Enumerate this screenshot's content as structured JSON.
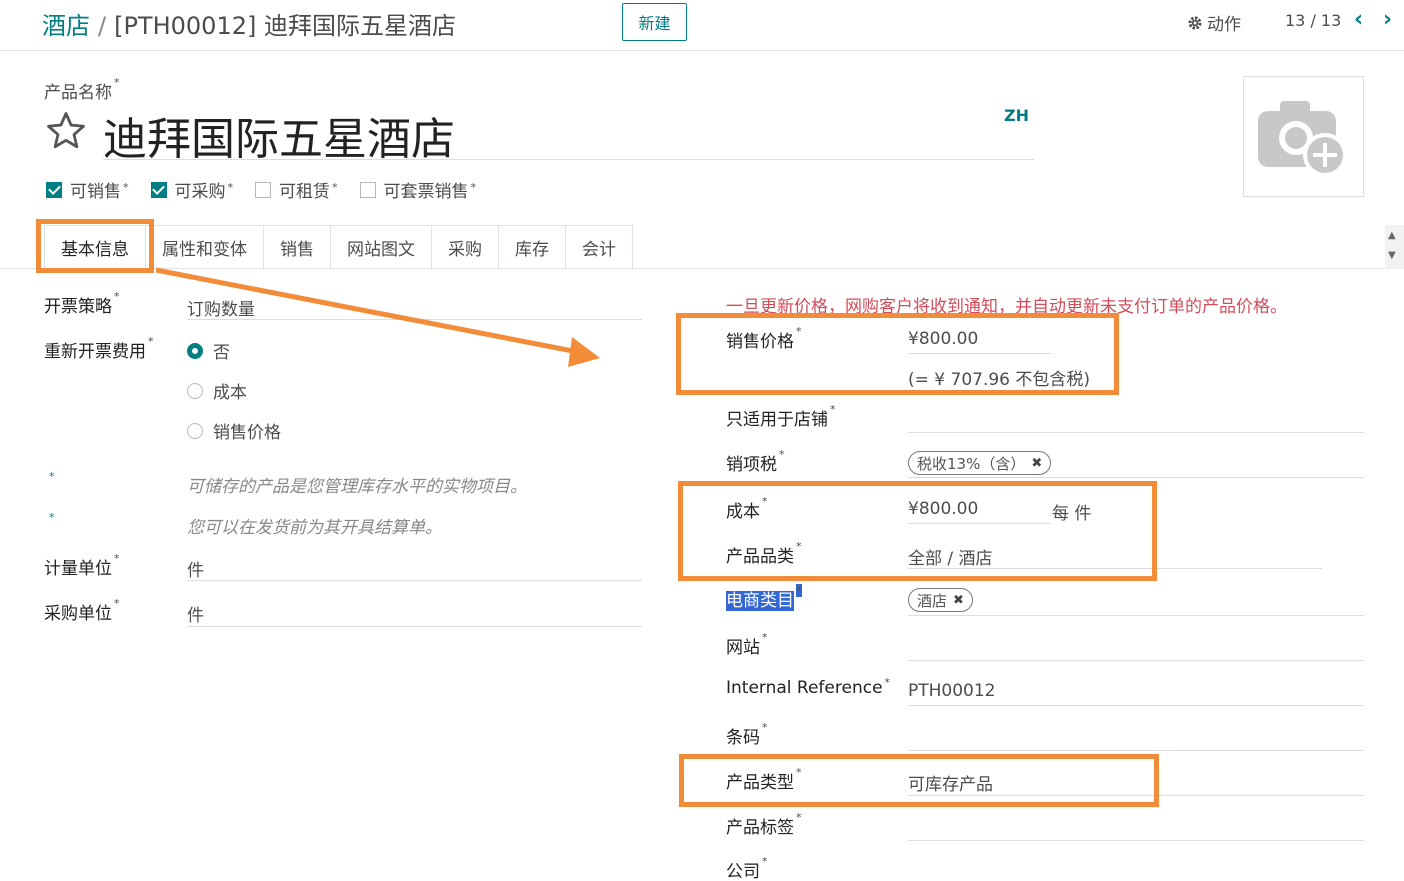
{
  "header": {
    "breadcrumb_root": "酒店",
    "breadcrumb_sep": "/",
    "breadcrumb_current": "[PTH00012] 迪拜国际五星酒店",
    "new_button": "新建",
    "actions_label": "动作",
    "pager": "13 / 13"
  },
  "product": {
    "name_label": "产品名称",
    "name": "迪拜国际五星酒店",
    "lang": "ZH",
    "checkboxes": [
      {
        "label": "可销售",
        "checked": true
      },
      {
        "label": "可采购",
        "checked": true
      },
      {
        "label": "可租赁",
        "checked": false
      },
      {
        "label": "可套票销售",
        "checked": false
      }
    ]
  },
  "tabs": [
    "基本信息",
    "属性和变体",
    "销售",
    "网站图文",
    "采购",
    "库存",
    "会计"
  ],
  "left": {
    "invoice_policy_label": "开票策略",
    "invoice_policy_value": "订购数量",
    "reinvoice_label": "重新开票费用",
    "reinvoice_options": [
      {
        "label": "否",
        "selected": true
      },
      {
        "label": "成本",
        "selected": false
      },
      {
        "label": "销售价格",
        "selected": false
      }
    ],
    "note1": "可储存的产品是您管理库存水平的实物项目。",
    "note2": "您可以在发货前为其开具结算单。",
    "uom_label": "计量单位",
    "uom_value": "件",
    "purchase_uom_label": "采购单位",
    "purchase_uom_value": "件"
  },
  "right": {
    "warning": "一旦更新价格，网购客户将收到通知，并自动更新未支付订单的产品价格。",
    "sale_price_label": "销售价格",
    "sale_price": "¥800.00",
    "sale_price_excl": "(= ¥ 707.96 不包含税)",
    "shop_only_label": "只适用于店铺",
    "sales_tax_label": "销项税",
    "sales_tax_tag": "税收13%（含）",
    "cost_label": "成本",
    "cost": "¥800.00",
    "cost_unit": "每 件",
    "category_label": "产品品类",
    "category": "全部 / 酒店",
    "ecom_category_label": "电商类目",
    "ecom_category_tag": "酒店",
    "website_label": "网站",
    "internal_ref_label": "Internal Reference",
    "internal_ref": "PTH00012",
    "barcode_label": "条码",
    "product_type_label": "产品类型",
    "product_type": "可库存产品",
    "product_tags_label": "产品标签",
    "company_label": "公司"
  },
  "colors": {
    "accent": "#017e84",
    "annotation": "#f28c38",
    "warning": "#d44c59"
  }
}
